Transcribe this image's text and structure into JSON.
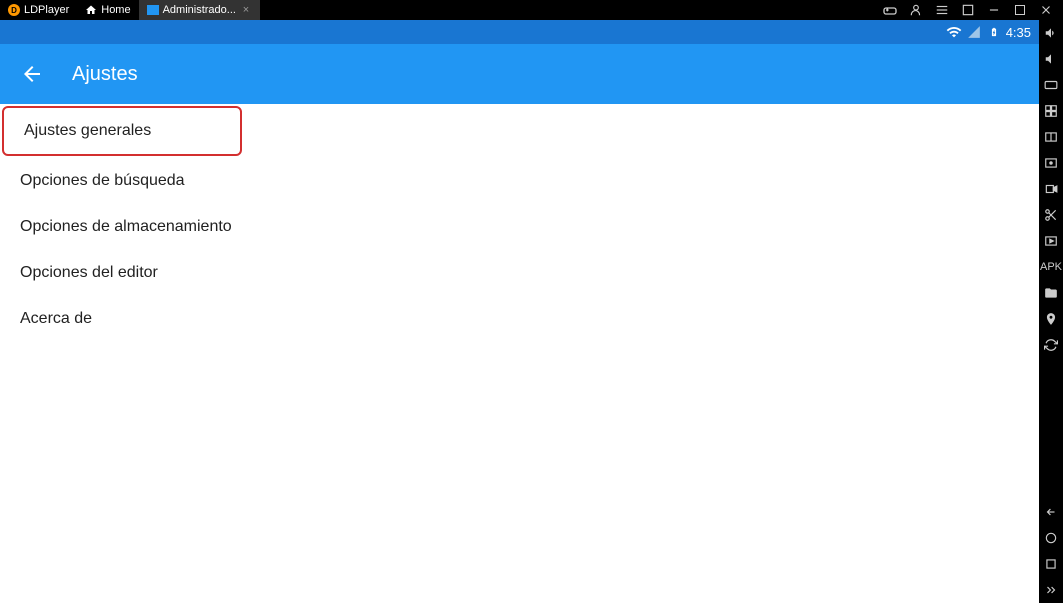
{
  "titlebar": {
    "app_name": "LDPlayer",
    "tabs": [
      {
        "label": "Home"
      },
      {
        "label": "Administrado..."
      }
    ]
  },
  "statusbar": {
    "time": "4:35"
  },
  "appbar": {
    "title": "Ajustes"
  },
  "settings": {
    "items": [
      {
        "label": "Ajustes generales",
        "highlighted": true
      },
      {
        "label": "Opciones de búsqueda",
        "highlighted": false
      },
      {
        "label": "Opciones de almacenamiento",
        "highlighted": false
      },
      {
        "label": "Opciones del editor",
        "highlighted": false
      },
      {
        "label": "Acerca de",
        "highlighted": false
      }
    ]
  }
}
